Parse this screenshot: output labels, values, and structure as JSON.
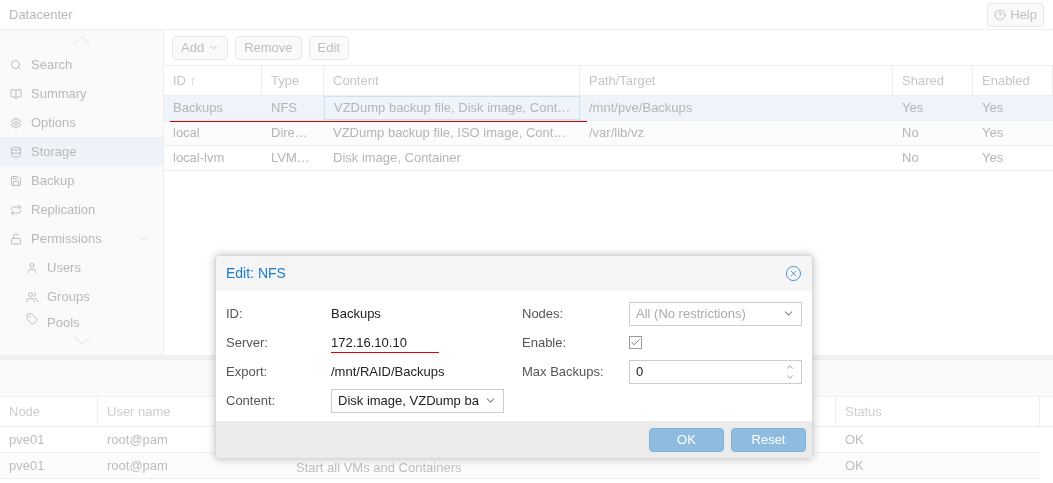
{
  "header": {
    "title": "Datacenter",
    "help_button": "Help"
  },
  "sidebar": {
    "items": [
      {
        "label": "Search",
        "selected": false
      },
      {
        "label": "Summary",
        "selected": false
      },
      {
        "label": "Options",
        "selected": false
      },
      {
        "label": "Storage",
        "selected": true
      },
      {
        "label": "Backup",
        "selected": false
      },
      {
        "label": "Replication",
        "selected": false
      },
      {
        "label": "Permissions",
        "selected": false,
        "expanded": true,
        "children": [
          {
            "label": "Users",
            "selected": false
          },
          {
            "label": "Groups",
            "selected": false
          },
          {
            "label": "Pools",
            "selected": false
          }
        ]
      }
    ]
  },
  "toolbar": {
    "buttons": [
      "Add",
      "Remove",
      "Edit"
    ]
  },
  "storage_table": {
    "columns": [
      "ID ↑",
      "Type",
      "Content",
      "Path/Target",
      "Shared",
      "Enabled"
    ],
    "rows": [
      {
        "selected": true,
        "cells": [
          "Backups",
          "NFS",
          "VZDump backup file, Disk image, Cont…",
          "/mnt/pve/Backups",
          "Yes",
          "Yes"
        ]
      },
      {
        "selected": false,
        "cells": [
          "local",
          "Dire…",
          "VZDump backup file, ISO image, Cont…",
          "/var/lib/vz",
          "No",
          "Yes"
        ]
      },
      {
        "selected": false,
        "cells": [
          "local-lvm",
          "LVM…",
          "Disk image, Container",
          "",
          "No",
          "Yes"
        ]
      }
    ]
  },
  "task_table": {
    "columns": [
      "Node",
      "User name",
      "",
      "Status"
    ],
    "rows": [
      {
        "cells": [
          "pve01",
          "root@pam",
          "",
          "OK"
        ]
      },
      {
        "cells": [
          "pve01",
          "root@pam",
          "Start all VMs and Containers",
          "OK"
        ]
      }
    ]
  },
  "dialog": {
    "title": "Edit: NFS",
    "left": [
      {
        "label": "ID:",
        "kind": "text",
        "value": "Backups"
      },
      {
        "label": "Server:",
        "kind": "text",
        "value": "172.16.10.10"
      },
      {
        "label": "Export:",
        "kind": "text",
        "value": "/mnt/RAID/Backups"
      },
      {
        "label": "Content:",
        "kind": "select",
        "value": "Disk image, VZDump ba"
      }
    ],
    "right": [
      {
        "label": "Nodes:",
        "kind": "select",
        "placeholder": "All (No restrictions)"
      },
      {
        "label": "Enable:",
        "kind": "checkbox",
        "checked": true
      },
      {
        "label": "Max Backups:",
        "kind": "spinner",
        "value": "0"
      }
    ],
    "buttons": [
      "OK",
      "Reset"
    ]
  }
}
